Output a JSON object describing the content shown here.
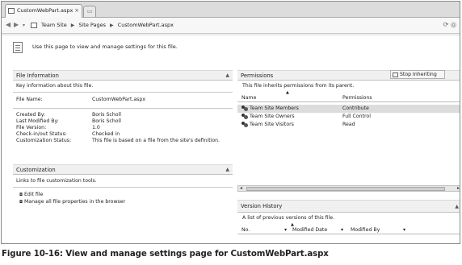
{
  "browser": {
    "tab_title": "CustomWebPart.aspx",
    "tab_close": "×",
    "breadcrumb": [
      "Team Site",
      "Site Pages",
      "CustomWebPart.aspx"
    ],
    "crumb_separator": "▶"
  },
  "intro": {
    "text": "Use this page to view and manage settings for this file."
  },
  "file_info": {
    "header": "File Information",
    "subtitle": "Key information about this file.",
    "file_name_label": "File Name:",
    "file_name_value": "CustomWebPart.aspx",
    "rows": [
      {
        "label": "Created By:",
        "value": "Boris Scholl"
      },
      {
        "label": "Last Modified By:",
        "value": "Boris Scholl"
      },
      {
        "label": "File Version:",
        "value": "1.0"
      },
      {
        "label": "Check-in/out Status:",
        "value": "Checked in"
      },
      {
        "label": "Customization Status:",
        "value": "This file is based on a file from the site's definition."
      }
    ]
  },
  "customization": {
    "header": "Customization",
    "subtitle": "Links to file customization tools.",
    "links": [
      "Edit file",
      "Manage all file properties in the browser"
    ]
  },
  "permissions": {
    "header": "Permissions",
    "stop_inheriting": "Stop Inheriting",
    "subtitle": "This file inherits permissions from its parent.",
    "col_name": "Name",
    "col_permissions": "Permissions",
    "rows": [
      {
        "name": "Team Site Members",
        "permission": "Contribute"
      },
      {
        "name": "Team Site Owners",
        "permission": "Full Control"
      },
      {
        "name": "Team Site Visitors",
        "permission": "Read"
      }
    ]
  },
  "version_history": {
    "header": "Version History",
    "subtitle": "A list of previous versions of this file.",
    "columns": [
      "No.",
      "Modified Date",
      "Modified By"
    ]
  },
  "caption": "Figure 10-16:  View and manage settings page for CustomWebPart.aspx"
}
